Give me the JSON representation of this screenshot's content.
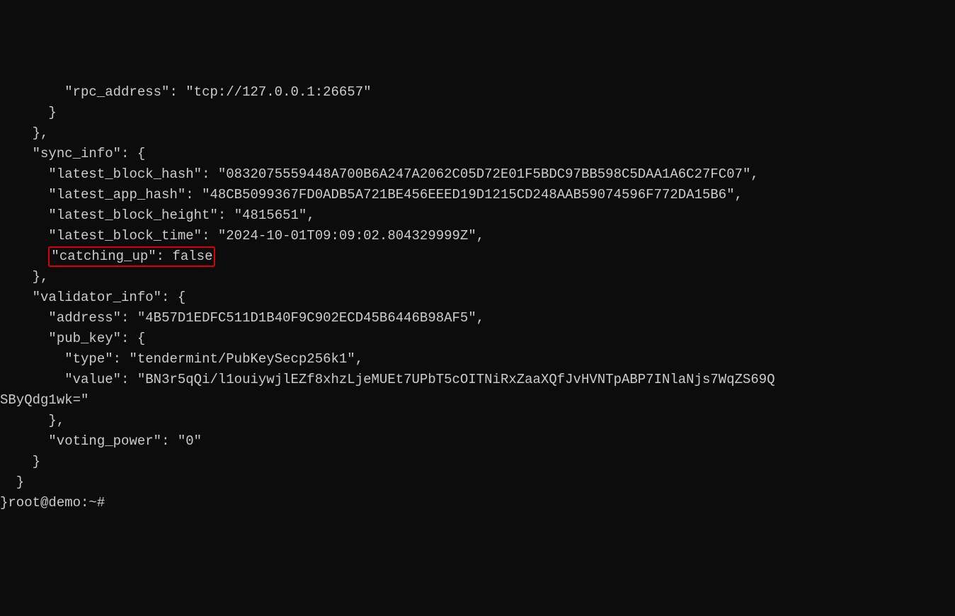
{
  "node_info": {
    "rpc_address_key": "\"rpc_address\"",
    "rpc_address_val": "\"tcp://127.0.0.1:26657\""
  },
  "sync_info": {
    "key": "\"sync_info\"",
    "latest_block_hash_key": "\"latest_block_hash\"",
    "latest_block_hash_val": "\"0832075559448A700B6A247A2062C05D72E01F5BDC97BB598C5DAA1A6C27FC07\"",
    "latest_app_hash_key": "\"latest_app_hash\"",
    "latest_app_hash_val": "\"48CB5099367FD0ADB5A721BE456EEED19D1215CD248AAB59074596F772DA15B6\"",
    "latest_block_height_key": "\"latest_block_height\"",
    "latest_block_height_val": "\"4815651\"",
    "latest_block_time_key": "\"latest_block_time\"",
    "latest_block_time_val": "\"2024-10-01T09:09:02.804329999Z\"",
    "catching_up_key": "\"catching_up\"",
    "catching_up_val": "false"
  },
  "validator_info": {
    "key": "\"validator_info\"",
    "address_key": "\"address\"",
    "address_val": "\"4B57D1EDFC511D1B40F9C902ECD45B6446B98AF5\"",
    "pub_key_key": "\"pub_key\"",
    "type_key": "\"type\"",
    "type_val": "\"tendermint/PubKeySecp256k1\"",
    "value_key": "\"value\"",
    "value_val_line1": "\"BN3r5qQi/l1ouiywjlEZf8xhzLjeMUEt7UPbT5cOITNiRxZaaXQfJvHVNTpABP7INlaNjs7WqZS69Q",
    "value_val_line2": "SByQdg1wk=\"",
    "voting_power_key": "\"voting_power\"",
    "voting_power_val": "\"0\""
  },
  "prompt": "root@demo:~#"
}
